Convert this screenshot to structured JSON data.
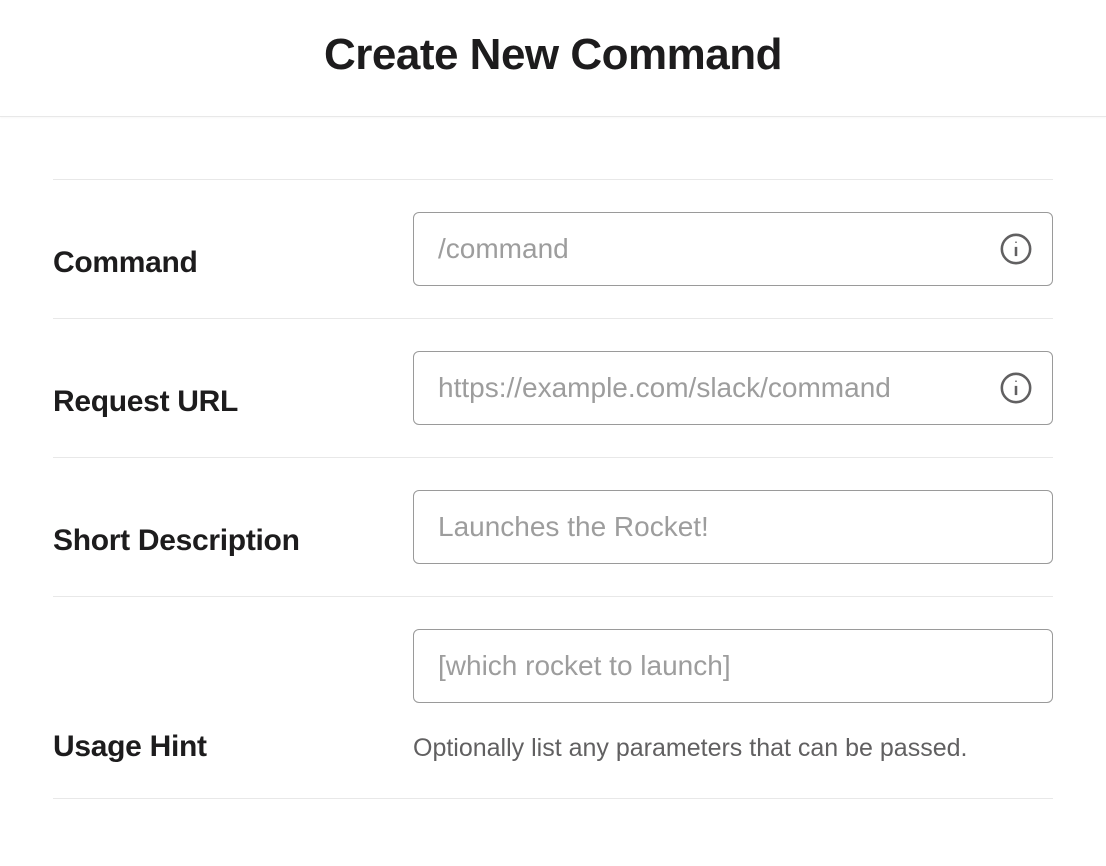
{
  "header": {
    "title": "Create New Command"
  },
  "fields": {
    "command": {
      "label": "Command",
      "placeholder": "/command",
      "value": ""
    },
    "request_url": {
      "label": "Request URL",
      "placeholder": "https://example.com/slack/command",
      "value": ""
    },
    "short_description": {
      "label": "Short Description",
      "placeholder": "Launches the Rocket!",
      "value": ""
    },
    "usage_hint": {
      "label": "Usage Hint",
      "placeholder": "[which rocket to launch]",
      "value": "",
      "helper": "Optionally list any parameters that can be passed."
    }
  }
}
